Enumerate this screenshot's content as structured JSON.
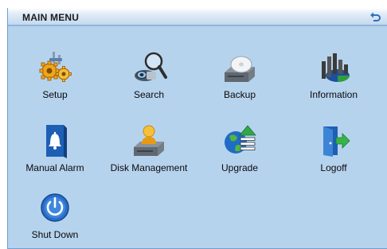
{
  "header": {
    "title": "MAIN MENU",
    "back_icon": "back-arrow-icon"
  },
  "menu": {
    "items": [
      {
        "label": "Setup",
        "icon": "gears-icon"
      },
      {
        "label": "Search",
        "icon": "magnifier-camera-icon"
      },
      {
        "label": "Backup",
        "icon": "disc-drive-icon"
      },
      {
        "label": "Information",
        "icon": "bar-chart-pie-icon"
      },
      {
        "label": "Manual Alarm",
        "icon": "alarm-bell-icon"
      },
      {
        "label": "Disk Management",
        "icon": "user-drive-icon"
      },
      {
        "label": "Upgrade",
        "icon": "globe-upload-icon"
      },
      {
        "label": "Logoff",
        "icon": "door-exit-icon"
      },
      {
        "label": "Shut Down",
        "icon": "power-icon"
      }
    ]
  },
  "colors": {
    "panel": "#b6d3ee",
    "accent": "#1d5fb5"
  }
}
